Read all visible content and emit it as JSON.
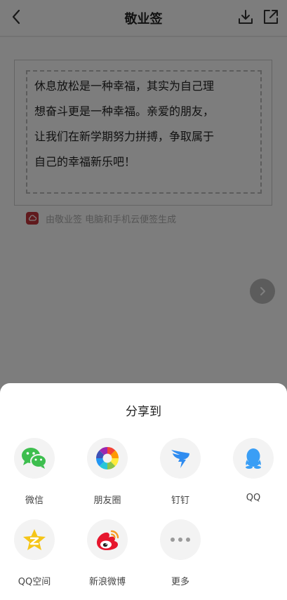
{
  "header": {
    "title": "敬业签"
  },
  "note": {
    "lines": [
      "休息放松是一种幸福，其实为自己理",
      "想奋斗更是一种幸福。亲爱的朋友，",
      "让我们在新学期努力拼搏，争取属于",
      "自己的幸福新乐吧！"
    ],
    "footer": "由敬业签 电脑和手机云便签生成"
  },
  "share_sheet": {
    "title": "分享到",
    "items": [
      {
        "label": "微信",
        "icon": "wechat-icon"
      },
      {
        "label": "朋友圈",
        "icon": "moments-icon"
      },
      {
        "label": "钉钉",
        "icon": "dingtalk-icon"
      },
      {
        "label": "QQ",
        "icon": "qq-icon"
      },
      {
        "label": "QQ空间",
        "icon": "qzone-icon"
      },
      {
        "label": "新浪微博",
        "icon": "weibo-icon"
      },
      {
        "label": "更多",
        "icon": "more-icon"
      }
    ]
  },
  "colors": {
    "wechat": "#3dbe4e",
    "dingtalk": "#2f8cf0",
    "qq": "#3a9ef5",
    "qzone": "#f5c518",
    "weibo": "#e6162d",
    "brand": "#c0343b"
  }
}
